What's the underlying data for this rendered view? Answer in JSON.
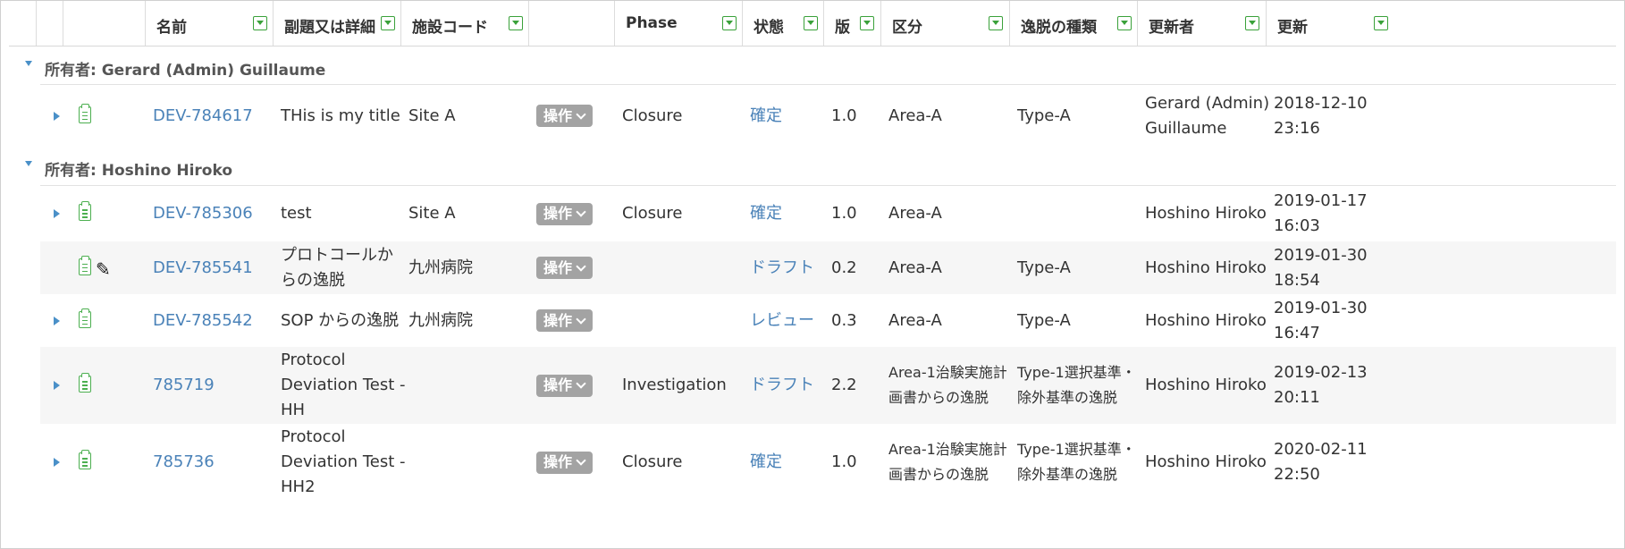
{
  "columns": {
    "name": "名前",
    "subtitle": "副題又は詳細",
    "site_code": "施設コード",
    "phase": "Phase",
    "status": "状態",
    "version": "版",
    "category": "区分",
    "deviation_type": "逸脱の種類",
    "updated_by": "更新者",
    "updated": "更新"
  },
  "groups": [
    {
      "label": "所有者: Gerard (Admin) Guillaume",
      "rows": [
        {
          "name": "DEV-784617",
          "subtitle": "THis is my title",
          "site": "Site A",
          "ops": "操作",
          "phase": "Closure",
          "status": "確定",
          "version": "1.0",
          "category": "Area-A",
          "type": "Type-A",
          "updated_by": "Gerard (Admin) Guillaume",
          "updated": "2018-12-10 23:16",
          "expandable": true,
          "editable": false
        }
      ]
    },
    {
      "label": "所有者: Hoshino Hiroko",
      "rows": [
        {
          "name": "DEV-785306",
          "subtitle": "test",
          "site": "Site A",
          "ops": "操作",
          "phase": "Closure",
          "status": "確定",
          "version": "1.0",
          "category": "Area-A",
          "type": "",
          "updated_by": "Hoshino Hiroko",
          "updated": "2019-01-17 16:03",
          "expandable": true,
          "editable": false
        },
        {
          "name": "DEV-785541",
          "subtitle": "プロトコールからの逸脱",
          "site": "九州病院",
          "ops": "操作",
          "phase": "",
          "status": "ドラフト",
          "version": "0.2",
          "category": "Area-A",
          "type": "Type-A",
          "updated_by": "Hoshino Hiroko",
          "updated": "2019-01-30 18:54",
          "expandable": false,
          "editable": true
        },
        {
          "name": "DEV-785542",
          "subtitle": "SOP からの逸脱",
          "site": "九州病院",
          "ops": "操作",
          "phase": "",
          "status": "レビュー",
          "version": "0.3",
          "category": "Area-A",
          "type": "Type-A",
          "updated_by": "Hoshino Hiroko",
          "updated": "2019-01-30 16:47",
          "expandable": true,
          "editable": false
        },
        {
          "name": "785719",
          "subtitle": "Protocol Deviation Test - HH",
          "site": "",
          "ops": "操作",
          "phase": "Investigation",
          "status": "ドラフト",
          "version": "2.2",
          "category": "Area-1治験実施計画書からの逸脱",
          "type": "Type-1選択基準・除外基準の逸脱",
          "updated_by": "Hoshino Hiroko",
          "updated": "2019-02-13 20:11",
          "expandable": true,
          "editable": false
        },
        {
          "name": "785736",
          "subtitle": "Protocol Deviation Test - HH2",
          "site": "",
          "ops": "操作",
          "phase": "Closure",
          "status": "確定",
          "version": "1.0",
          "category": "Area-1治験実施計画書からの逸脱",
          "type": "Type-1選択基準・除外基準の逸脱",
          "updated_by": "Hoshino Hiroko",
          "updated": "2020-02-11 22:50",
          "expandable": true,
          "editable": false
        }
      ]
    }
  ],
  "colors": {
    "link": "#4a82b8",
    "filter_icon": "#3aa13a",
    "clipboard_icon": "#4caf50",
    "ops_button": "#a3a3a3",
    "alt_row": "#f6f6f6"
  }
}
